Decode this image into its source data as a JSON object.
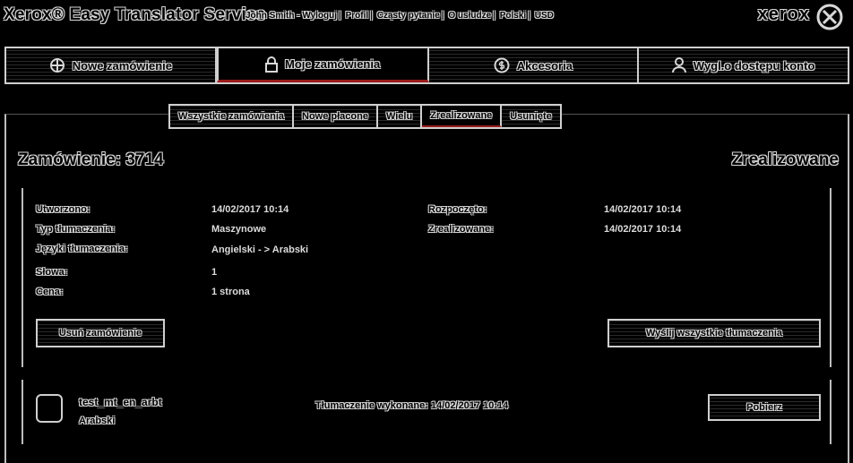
{
  "header": {
    "app_title": "Xerox® Easy Translator Service",
    "links": [
      "John Smith - Wyloguj",
      "Profil",
      "Cząsty pytanie",
      "O usłudze",
      "Polski",
      "USD"
    ],
    "brand": "xerox"
  },
  "main_nav": [
    {
      "label": "Nowe zamówienie",
      "icon": "new-order-icon",
      "active": false
    },
    {
      "label": "Moje zamówienia",
      "icon": "lock-icon",
      "active": true
    },
    {
      "label": "Akcesoria",
      "icon": "currency-icon",
      "active": false
    },
    {
      "label": "Wygl.o dostępu konto",
      "icon": "user-icon",
      "active": false
    }
  ],
  "sub_tabs": [
    {
      "label": "Wszystkie zamówienia",
      "active": false
    },
    {
      "label": "Nowe płacone",
      "active": false
    },
    {
      "label": "Wielu",
      "active": false
    },
    {
      "label": "Zrealizowane",
      "active": true
    },
    {
      "label": "Usunięte",
      "active": false
    }
  ],
  "order": {
    "heading": "Zamówienie: 3714",
    "status": "Zrealizowane",
    "fields_left": [
      {
        "label": "Utworzono:",
        "value": "14/02/2017 10:14"
      },
      {
        "label": "Typ tłumaczenia:",
        "value": "Maszynowe"
      },
      {
        "label": "Języki tłumaczenia:",
        "value": "Angielski - > Arabski"
      },
      {
        "label": "Słowa:",
        "value": "1"
      },
      {
        "label": "Cena:",
        "value": "1 strona"
      }
    ],
    "fields_right": [
      {
        "label": "Rozpoczęto:",
        "value": "14/02/2017 10:14"
      },
      {
        "label": "Zrealizowane:",
        "value": "14/02/2017 10:14"
      }
    ],
    "delete_button": "Usuń zamówienie",
    "download_all_button": "Wyślij wszystkie tłumaczenia"
  },
  "file": {
    "name": "test_mt_en_arbt",
    "language": "Arabski",
    "status": "Tłumaczenie wykonane: 14/02/2017 10:14",
    "action_button": "Pobierz"
  },
  "colors": {
    "accent": "#9a1c1c",
    "outline": "#d8d8d8",
    "background": "#000000"
  }
}
